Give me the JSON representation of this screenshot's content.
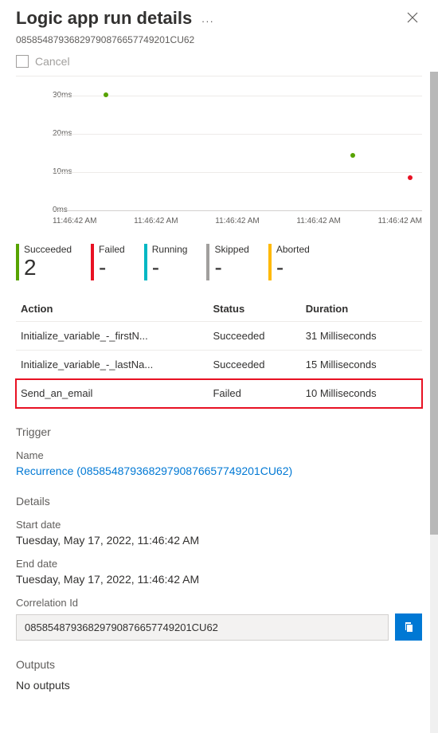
{
  "header": {
    "title": "Logic app run details",
    "more_icon": "···",
    "run_id": "08585487936829790876657749201CU62",
    "cancel_label": "Cancel"
  },
  "chart_data": {
    "type": "scatter",
    "xlabel": "",
    "ylabel": "",
    "ylim": [
      0,
      30
    ],
    "x_ticks": [
      "11:46:42 AM",
      "11:46:42 AM",
      "11:46:42 AM",
      "11:46:42 AM",
      "11:46:42 AM"
    ],
    "y_ticks": [
      "0ms",
      "10ms",
      "20ms",
      "30ms"
    ],
    "series": [
      {
        "name": "Succeeded",
        "color": "#57a300",
        "points": [
          {
            "x": 0,
            "y": 30
          },
          {
            "x": 3,
            "y": 15
          }
        ]
      },
      {
        "name": "Failed",
        "color": "#e81123",
        "points": [
          {
            "x": 4,
            "y": 10
          }
        ]
      }
    ]
  },
  "status_tabs": [
    {
      "label": "Succeeded",
      "value": "2",
      "color": "c-succ"
    },
    {
      "label": "Failed",
      "value": "-",
      "color": "c-fail"
    },
    {
      "label": "Running",
      "value": "-",
      "color": "c-run"
    },
    {
      "label": "Skipped",
      "value": "-",
      "color": "c-skip"
    },
    {
      "label": "Aborted",
      "value": "-",
      "color": "c-abort"
    }
  ],
  "table": {
    "headers": {
      "action": "Action",
      "status": "Status",
      "duration": "Duration"
    },
    "rows": [
      {
        "action": "Initialize_variable_-_firstN...",
        "status": "Succeeded",
        "duration": "31 Milliseconds",
        "highlight": false
      },
      {
        "action": "Initialize_variable_-_lastNa...",
        "status": "Succeeded",
        "duration": "15 Milliseconds",
        "highlight": false
      },
      {
        "action": "Send_an_email",
        "status": "Failed",
        "duration": "10 Milliseconds",
        "highlight": true
      }
    ]
  },
  "trigger": {
    "heading": "Trigger",
    "name_label": "Name",
    "name_link": "Recurrence (08585487936829790876657749201CU62)"
  },
  "details": {
    "heading": "Details",
    "start_label": "Start date",
    "start_value": "Tuesday, May 17, 2022, 11:46:42 AM",
    "end_label": "End date",
    "end_value": "Tuesday, May 17, 2022, 11:46:42 AM",
    "corr_label": "Correlation Id",
    "corr_value": "08585487936829790876657749201CU62"
  },
  "outputs": {
    "heading": "Outputs",
    "value": "No outputs"
  }
}
